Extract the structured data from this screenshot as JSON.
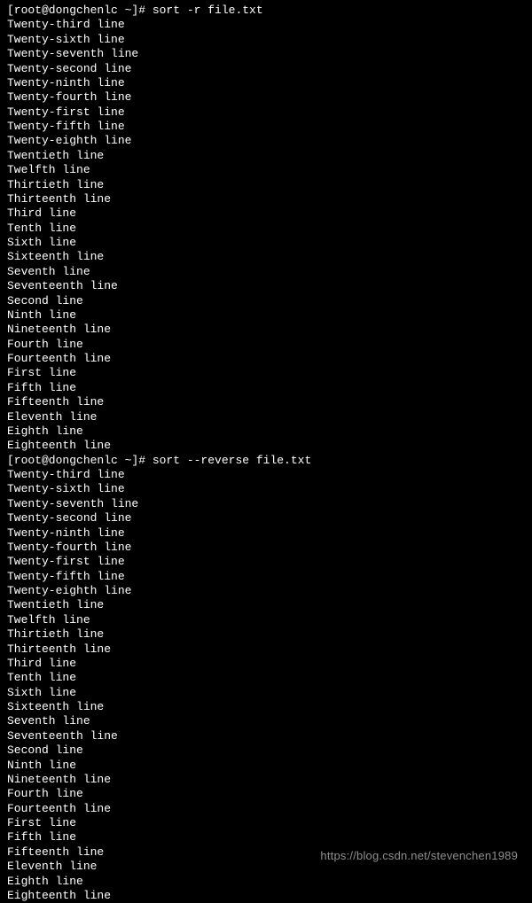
{
  "prompts": [
    {
      "prefix": "[root@dongchenlc ~]# ",
      "command": "sort -r file.txt"
    },
    {
      "prefix": "[root@dongchenlc ~]# ",
      "command": "sort --reverse file.txt"
    }
  ],
  "output_lines": [
    "Twenty-third line",
    "Twenty-sixth line",
    "Twenty-seventh line",
    "Twenty-second line",
    "Twenty-ninth line",
    "Twenty-fourth line",
    "Twenty-first line",
    "Twenty-fifth line",
    "Twenty-eighth line",
    "Twentieth line",
    "Twelfth line",
    "Thirtieth line",
    "Thirteenth line",
    "Third line",
    "Tenth line",
    "Sixth line",
    "Sixteenth line",
    "Seventh line",
    "Seventeenth line",
    "Second line",
    "Ninth line",
    "Nineteenth line",
    "Fourth line",
    "Fourteenth line",
    "First line",
    "Fifth line",
    "Fifteenth line",
    "Eleventh line",
    "Eighth line",
    "Eighteenth line"
  ],
  "watermark": "https://blog.csdn.net/stevenchen1989"
}
